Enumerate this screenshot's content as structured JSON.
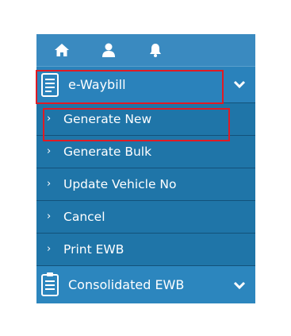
{
  "topbar": {
    "icons": [
      "home-icon",
      "user-icon",
      "bell-icon"
    ]
  },
  "menu": {
    "section_label": "e-Waybill",
    "items": [
      {
        "label": "Generate New"
      },
      {
        "label": "Generate Bulk"
      },
      {
        "label": "Update Vehicle No"
      },
      {
        "label": "Cancel"
      },
      {
        "label": "Print EWB"
      }
    ],
    "arrow": "›",
    "consolidated_label": "Consolidated EWB"
  },
  "colors": {
    "menu_bg": "#1f75a8",
    "topbar_bg": "#3a8ac0",
    "highlight": "#e01b24"
  }
}
